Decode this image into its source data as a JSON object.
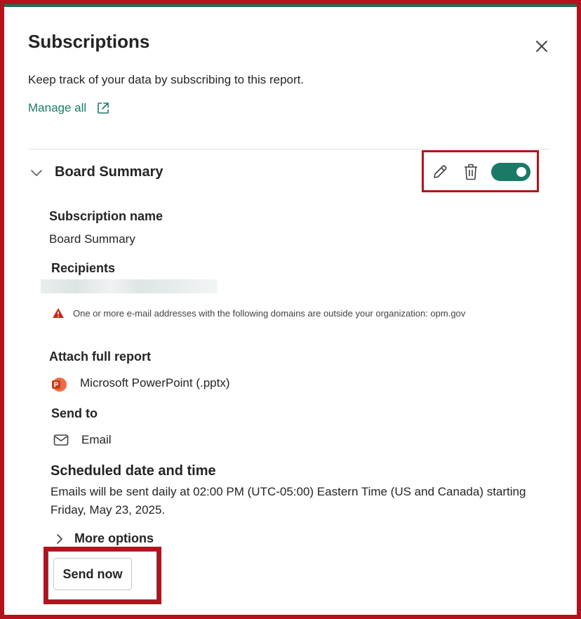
{
  "header": {
    "title": "Subscriptions",
    "description": "Keep track of your data by subscribing to this report.",
    "manage_all_label": "Manage all"
  },
  "subscription": {
    "name": "Board Summary",
    "enabled": true,
    "fields": {
      "subscription_name_label": "Subscription name",
      "subscription_name_value": "Board Summary",
      "recipients_label": "Recipients",
      "warning_text": "One or more e-mail addresses with the following domains are outside your organization: opm.gov",
      "attach_label": "Attach full report",
      "attach_value": "Microsoft PowerPoint (.pptx)",
      "send_to_label": "Send to",
      "send_to_value": "Email",
      "schedule_label": "Scheduled date and time",
      "schedule_text": "Emails will be sent daily at 02:00 PM (UTC-05:00) Eastern Time (US and Canada) starting Friday, May 23, 2025."
    },
    "more_options_label": "More options",
    "send_now_label": "Send now"
  },
  "icons": {
    "close": "close-icon",
    "manage_all": "open-external-icon",
    "collapse": "chevron-down-icon",
    "edit": "pencil-icon",
    "delete": "trash-icon",
    "warning": "warning-icon",
    "attachment": "powerpoint-icon",
    "send_to": "mail-icon",
    "more_options": "chevron-right-icon"
  },
  "colors": {
    "accent": "#1b7a66",
    "highlight": "#b5121b",
    "warning": "#c42b1c",
    "powerpoint": "#c43e1c"
  }
}
